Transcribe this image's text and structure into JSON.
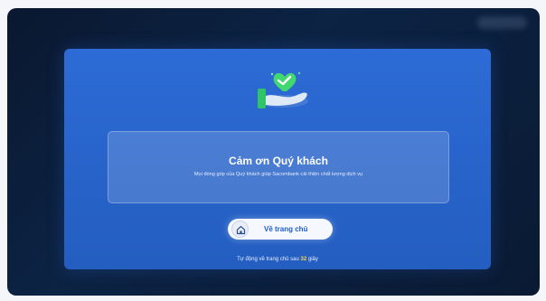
{
  "colors": {
    "modal_blue": "#2763c9",
    "accent_green": "#3fd16a",
    "countdown_highlight": "#ffd54a"
  },
  "card": {
    "title": "Cảm ơn Quý khách",
    "subtitle": "Mọi đóng góp của Quý khách giúp Sacombank cải thiện chất lượng dịch vụ"
  },
  "home_button": {
    "icon": "home-icon",
    "label": "Về trang chủ"
  },
  "countdown": {
    "prefix": "Tự động về trang chủ sau",
    "seconds": "32",
    "suffix": "giây"
  }
}
